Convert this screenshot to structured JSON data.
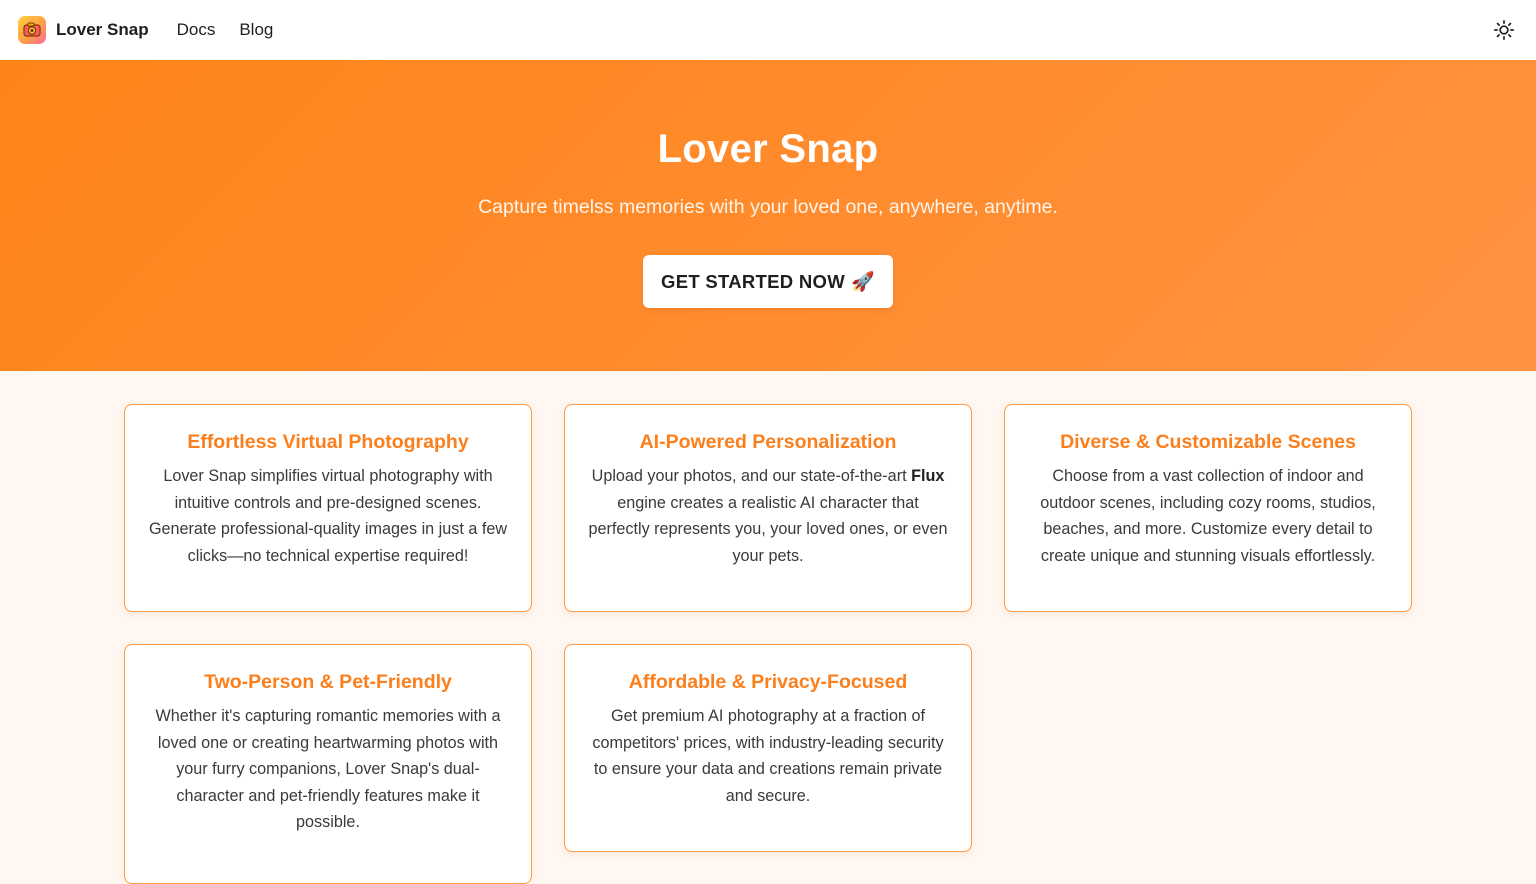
{
  "nav": {
    "brand": "Lover Snap",
    "links": [
      "Docs",
      "Blog"
    ],
    "logo_icon": "camera-heart-icon",
    "theme_icon": "sun-icon"
  },
  "hero": {
    "title": "Lover Snap",
    "subtitle": "Capture timelss memories with your loved one, anywhere, anytime.",
    "cta_label": "GET STARTED NOW",
    "cta_emoji": "🚀"
  },
  "features": [
    {
      "title": "Effortless Virtual Photography",
      "body": "Lover Snap simplifies virtual photography with intuitive controls and pre-designed scenes. Generate professional-quality images in just a few clicks—no technical expertise required!"
    },
    {
      "title": "AI-Powered Personalization",
      "body_before": "Upload your photos, and our state-of-the-art ",
      "body_bold": "Flux",
      "body_after": " engine creates a realistic AI character that perfectly represents you, your loved ones, or even your pets."
    },
    {
      "title": "Diverse & Customizable Scenes",
      "body": "Choose from a vast collection of indoor and outdoor scenes, including cozy rooms, studios, beaches, and more. Customize every detail to create unique and stunning visuals effortlessly."
    },
    {
      "title": "Two-Person & Pet-Friendly",
      "body": "Whether it's capturing romantic memories with a loved one or creating heartwarming photos with your furry companions, Lover Snap's dual-character and pet-friendly features make it possible."
    },
    {
      "title": "Affordable & Privacy-Focused",
      "body": "Get premium AI photography at a fraction of competitors' prices, with industry-leading security to ensure your data and creations remain private and secure."
    }
  ],
  "colors": {
    "accent": "#fb7f1c",
    "hero_start": "#ff8418",
    "hero_end": "#ff9342",
    "card_border": "#ff9a45",
    "page_bg": "#fff7f1"
  }
}
